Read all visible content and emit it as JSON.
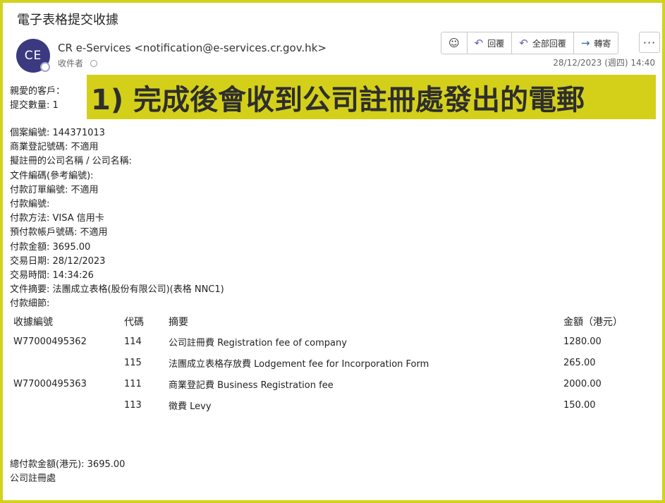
{
  "email": {
    "subject": "電子表格提交收據",
    "avatar_initials": "CE",
    "sender": "CR e-Services <notification@e-services.cr.gov.hk>",
    "recipient_label": "收件者",
    "date": "28/12/2023 (週四) 14:40"
  },
  "toolbar": {
    "emoji_icon": "emoji-icon",
    "reply_label": "回覆",
    "reply_all_label": "全部回覆",
    "forward_label": "轉寄",
    "more_label": "···"
  },
  "banner": {
    "text": "1) 完成後會收到公司註冊處發出的電郵",
    "color": "#d4d01a"
  },
  "greeting": {
    "line1": "親愛的客戶：",
    "line2": "提交數量: 1"
  },
  "details": [
    "個案編號: 144371013",
    "商業登記號碼: 不適用",
    "擬註冊的公司名稱 / 公司名稱:",
    "文件編碼(參考編號):",
    "付款訂單編號: 不適用",
    "付款編號:",
    "付款方法: VISA 信用卡",
    "預付款帳戶號碼: 不適用",
    "付款金額: 3695.00",
    "交易日期: 28/12/2023",
    "交易時間: 14:34:26",
    "文件摘要: 法團成立表格(股份有限公司)(表格 NNC1)",
    "付款細節:"
  ],
  "fees_table": {
    "headers": [
      "收據編號",
      "代碼",
      "摘要",
      "金額（港元）"
    ],
    "rows": [
      [
        "W77000495362",
        "114",
        "公司註冊費 Registration fee of company",
        "1280.00"
      ],
      [
        "",
        "115",
        "法團成立表格存放費 Lodgement fee for Incorporation Form",
        "265.00"
      ],
      [
        "W77000495363",
        "111",
        "商業登記費 Business Registration fee",
        "2000.00"
      ],
      [
        "",
        "113",
        "徵費 Levy",
        "150.00"
      ]
    ]
  },
  "footer": {
    "total": "總付款金額(港元): 3695.00",
    "signature": "公司註冊處"
  }
}
